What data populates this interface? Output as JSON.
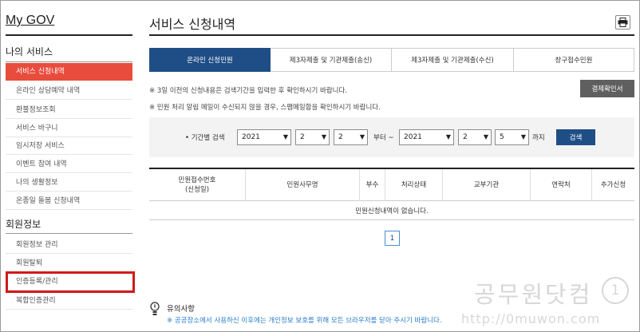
{
  "sidebar": {
    "title": "My GOV",
    "section1": "나의 서비스",
    "items1": [
      "서비스 신청내역",
      "온라인 상담예약 내역",
      "환불정보조회",
      "서비스 바구니",
      "임시저장 서비스",
      "이벤트 참여 내역",
      "나의 생활정보",
      "온종일 돌봄 신청내역"
    ],
    "section2": "회원정보",
    "items2": [
      "회원정보 관리",
      "회원탈퇴",
      "인증등록/관리",
      "복합인증관리"
    ]
  },
  "main": {
    "title": "서비스 신청내역",
    "tabs": [
      "온라인 신청민원",
      "제3자제출 및 기관제출(송신)",
      "제3자제출 및 기관제출(수신)",
      "창구접수민원"
    ],
    "notice1": "※ 3일 이전의 신청내용은 검색기간을 입력한 후 확인하시기 바랍니다.",
    "notice2": "※ 민원 처리 알림 메일이 수신되지 않을 경우, 스팸메일함을 확인하시기 바랍니다.",
    "pay_button": "결제확인서",
    "search": {
      "label": "• 기간별 검색",
      "from_year": "2021",
      "from_month": "2",
      "from_day": "2",
      "from_text": "부터 ~",
      "to_year": "2021",
      "to_month": "2",
      "to_day": "5",
      "to_text": "까지",
      "button": "검색"
    },
    "table": {
      "headers": [
        "민원접수번호\n(신청일)",
        "민원사무명",
        "부수",
        "처리상태",
        "교부기관",
        "연락처",
        "추가신청"
      ],
      "empty": "민원신청내역이 없습니다."
    },
    "pagination": {
      "current": "1"
    },
    "caution": {
      "title": "유의사항",
      "text": "※ 공공장소에서 사용하신 이후에는 개인정보 보호를 위해 모든 브라우저를 닫아 주시기 바랍니다."
    }
  },
  "watermark": {
    "name": "공무원닷컴",
    "badge": "1",
    "url": "http://0muwon.com"
  },
  "colors": {
    "active_red": "#e84c3d",
    "navy": "#1f4e86",
    "highlight": "#d11a1a",
    "caution_blue": "#2a7fc9"
  }
}
